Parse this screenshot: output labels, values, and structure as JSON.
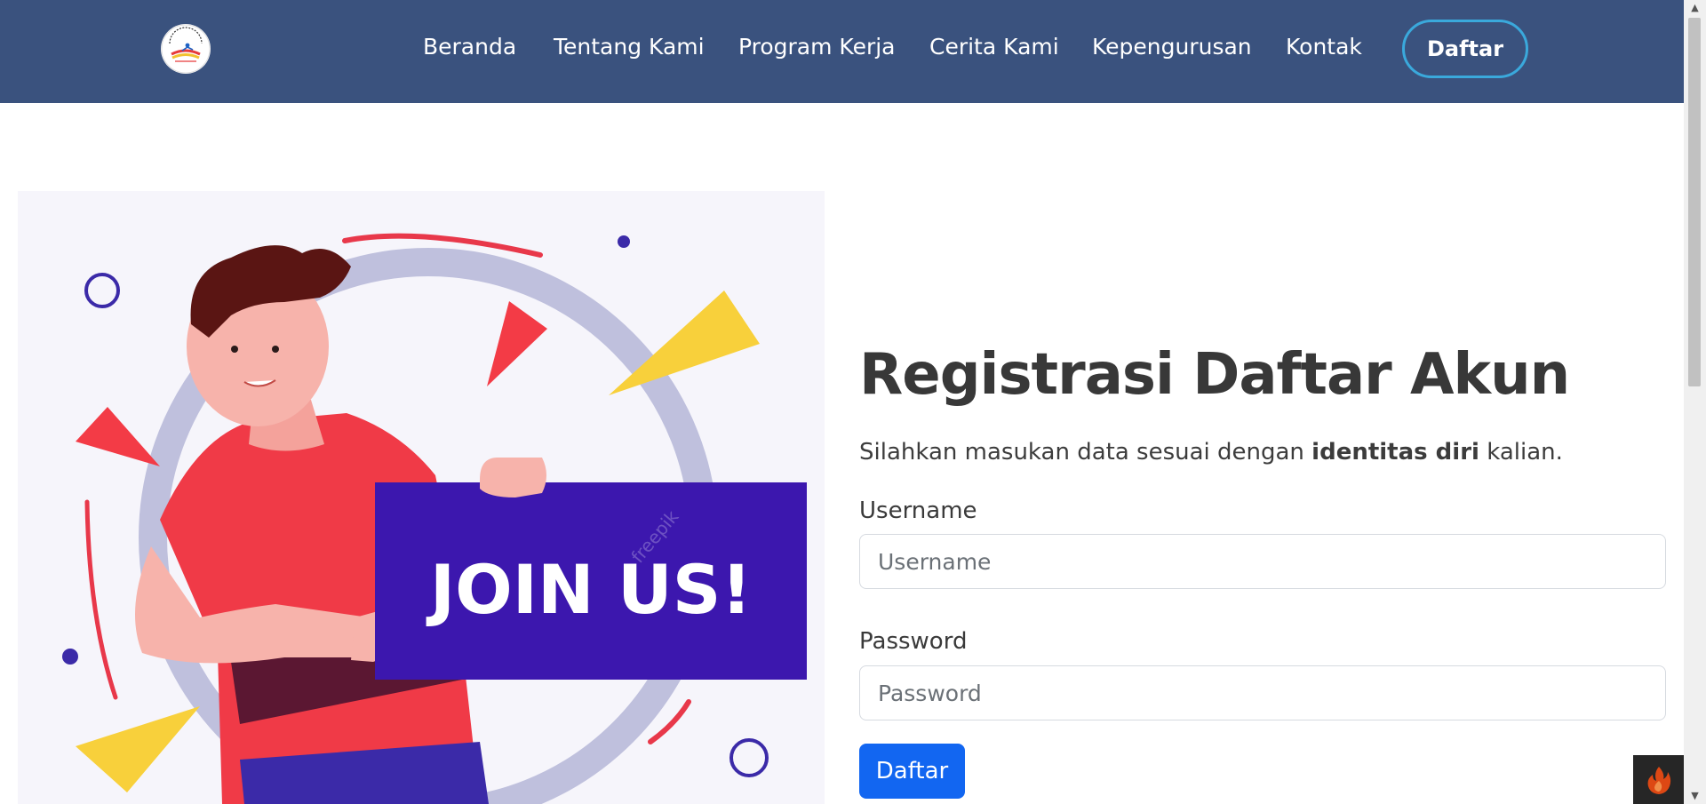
{
  "header": {
    "logo_icon": "organization-logo",
    "nav": [
      "Beranda",
      "Tentang Kami",
      "Program Kerja",
      "Cerita Kami",
      "Kepengurusan",
      "Kontak"
    ],
    "cta_label": "Daftar",
    "colors": {
      "bar": "#3a527e",
      "cta_border": "#3aa9dc"
    }
  },
  "illustration": {
    "sign_text": "JOIN US!",
    "watermark": "freepik"
  },
  "form": {
    "title": "Registrasi Daftar Akun",
    "subtitle_pre": "Silahkan masukan data sesuai dengan ",
    "subtitle_bold": "identitas diri",
    "subtitle_post": " kalian.",
    "username_label": "Username",
    "username_placeholder": "Username",
    "username_value": "",
    "password_label": "Password",
    "password_placeholder": "Password",
    "password_value": "",
    "submit_label": "Daftar",
    "colors": {
      "submit": "#1266f1"
    }
  },
  "widgets": {
    "debug_toolbar_icon": "flame-icon"
  }
}
